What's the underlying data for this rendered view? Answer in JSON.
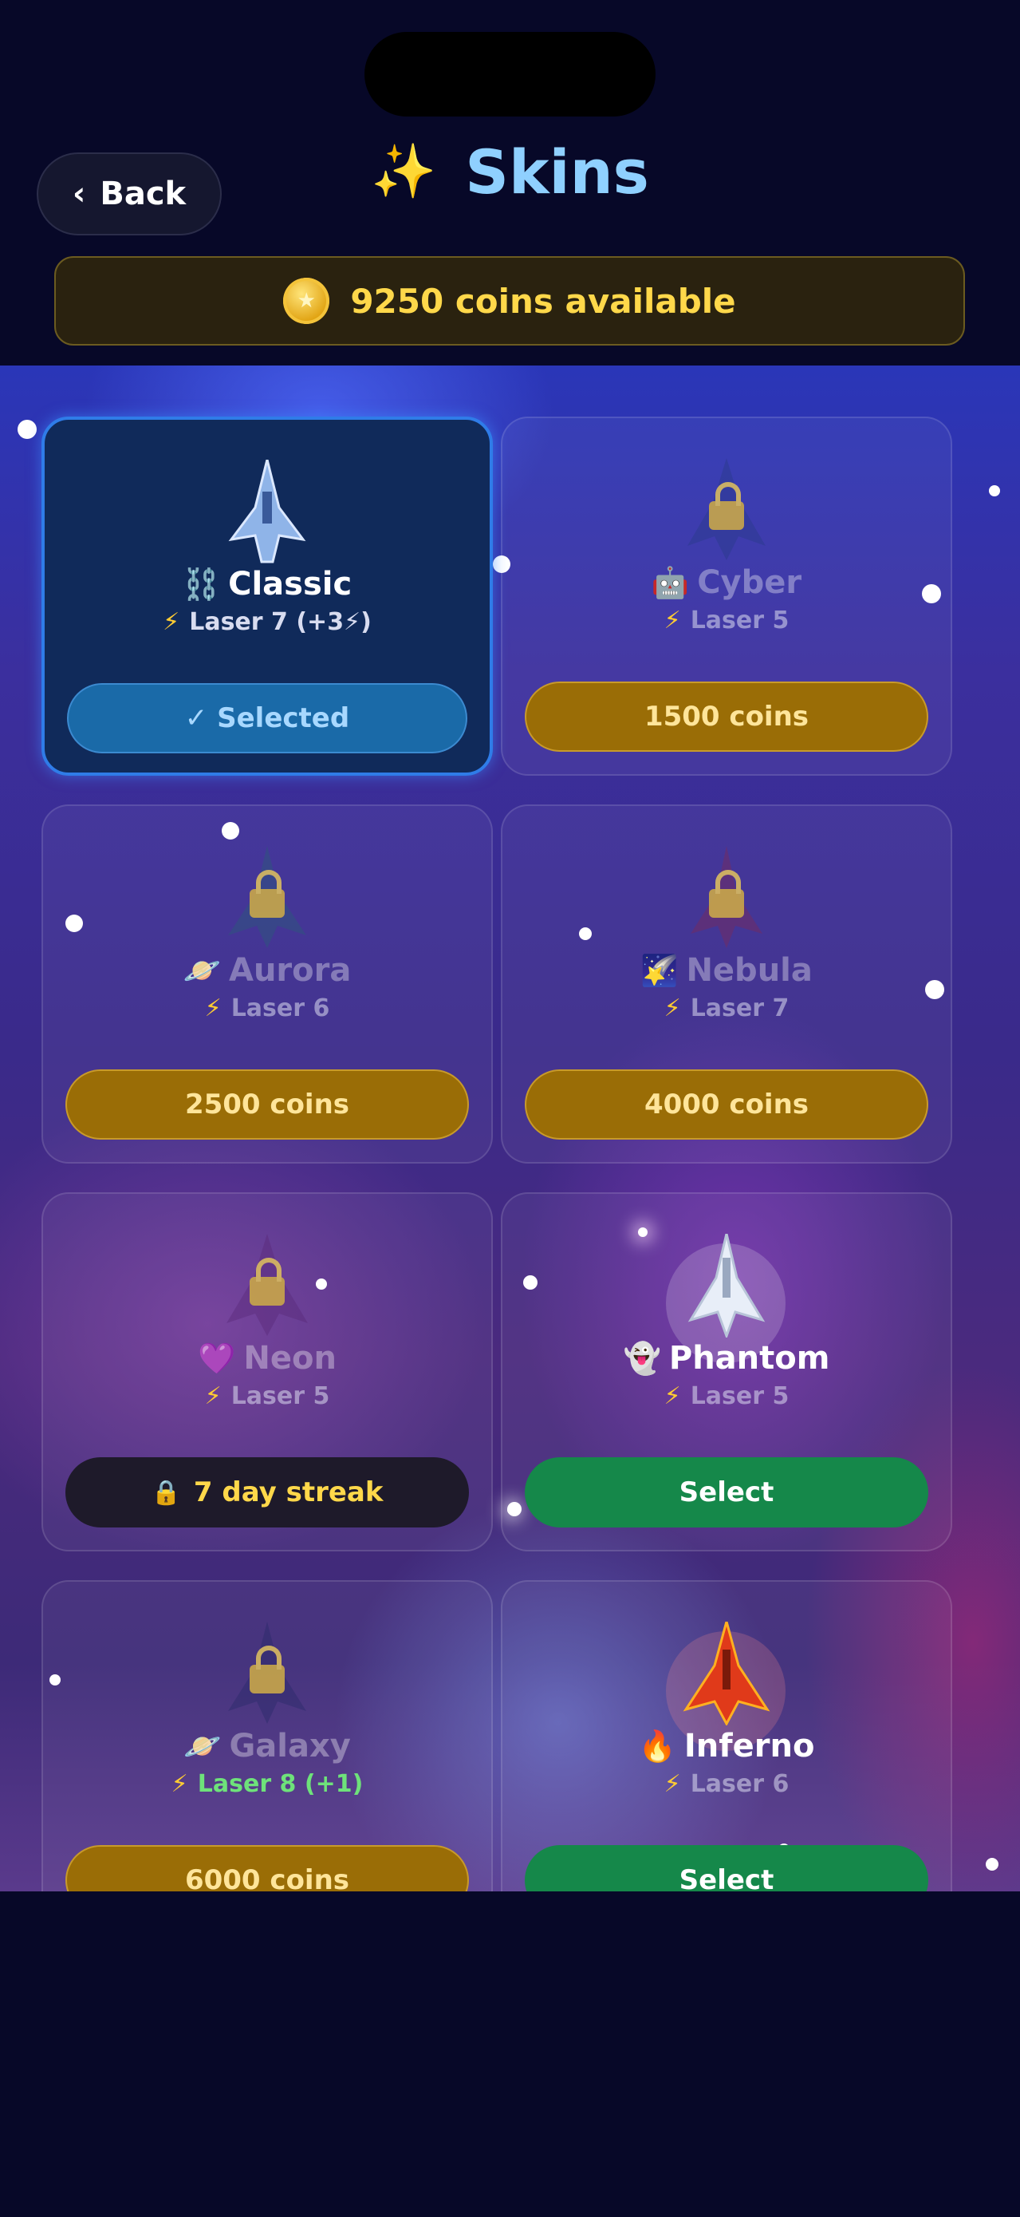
{
  "header": {
    "back_label": "Back",
    "title": "Skins",
    "title_icon": "sparkles-icon"
  },
  "wallet": {
    "text": "9250 coins available"
  },
  "colors": {
    "accent_gold": "#ffd84a",
    "title_blue": "#8fd0ff",
    "select_green": "#15884a",
    "selected_blue": "#2f7ce8"
  },
  "skins": [
    {
      "emoji": "⛓️",
      "name": "Classic",
      "weapon": "Laser 7 (+3⚡)",
      "action": "✓ Selected",
      "state": "selected",
      "ship_color": "#8fb4e8"
    },
    {
      "emoji": "🤖",
      "name": "Cyber",
      "weapon": "Laser 5",
      "action": "1500 coins",
      "state": "locked",
      "ship_color": "#2a3a8a"
    },
    {
      "emoji": "🪐",
      "name": "Aurora",
      "weapon": "Laser 6",
      "action": "2500 coins",
      "state": "locked",
      "ship_color": "#2a5a7a"
    },
    {
      "emoji": "🌠",
      "name": "Nebula",
      "weapon": "Laser 7",
      "action": "4000 coins",
      "state": "locked",
      "ship_color": "#7a2a5a"
    },
    {
      "emoji": "💜",
      "name": "Neon",
      "weapon": "Laser 5",
      "action": "7 day streak",
      "state": "streak",
      "ship_color": "#5a2a7a"
    },
    {
      "emoji": "👻",
      "name": "Phantom",
      "weapon": "Laser 5",
      "action": "Select",
      "state": "owned",
      "ship_color": "#e8eef8"
    },
    {
      "emoji": "🪐",
      "name": "Galaxy",
      "weapon": "Laser 8  (+1)",
      "action": "6000 coins",
      "state": "locked",
      "ship_color": "#2a2a6a"
    },
    {
      "emoji": "🔥",
      "name": "Inferno",
      "weapon": "Laser 6",
      "action": "Select",
      "state": "owned",
      "ship_color": "#e03a1a"
    }
  ]
}
